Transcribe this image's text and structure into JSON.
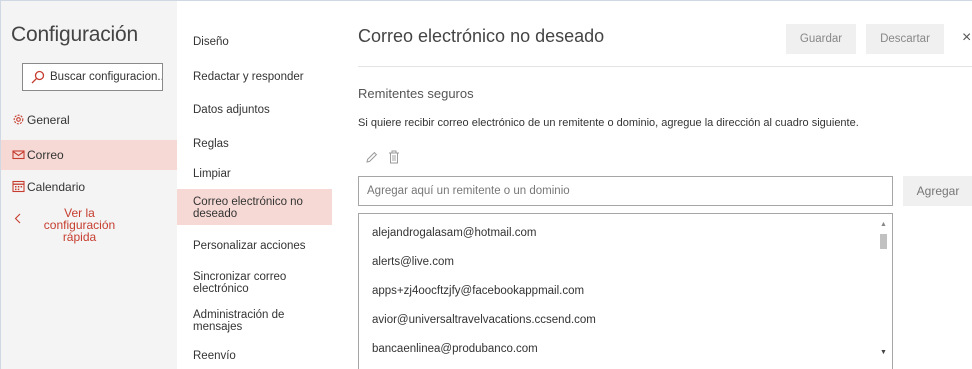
{
  "leftnav": {
    "title": "Configuración",
    "search_placeholder": "Buscar configuracion...",
    "items": [
      {
        "label": "General",
        "icon": "gear-icon"
      },
      {
        "label": "Correo",
        "icon": "mail-icon"
      },
      {
        "label": "Calendario",
        "icon": "calendar-icon"
      },
      {
        "label": "Ver la configuración rápida",
        "icon": "chevron-left-icon"
      }
    ]
  },
  "midnav": {
    "items": [
      {
        "label": "Diseño"
      },
      {
        "label": "Redactar y responder"
      },
      {
        "label": "Datos adjuntos"
      },
      {
        "label": "Reglas"
      },
      {
        "label": "Limpiar"
      },
      {
        "label": "Correo electrónico no deseado"
      },
      {
        "label": "Personalizar acciones"
      },
      {
        "label": "Sincronizar correo electrónico"
      },
      {
        "label": "Administración de mensajes"
      },
      {
        "label": "Reenvío"
      }
    ]
  },
  "main": {
    "title": "Correo electrónico no deseado",
    "save_label": "Guardar",
    "discard_label": "Descartar",
    "close_symbol": "×",
    "section_title": "Remitentes seguros",
    "description": "Si quiere recibir correo electrónico de un remitente o dominio, agregue la dirección al cuadro siguiente.",
    "add_placeholder": "Agregar aquí un remitente o un dominio",
    "add_label": "Agregar",
    "safe_senders": [
      "alejandrogalasam@hotmail.com",
      "alerts@live.com",
      "apps+zj4oocftzjfy@facebookappmail.com",
      "avior@universaltravelvacations.ccsend.com",
      "bancaenlinea@produbanco.com"
    ]
  },
  "colors": {
    "accent": "#c63d2f",
    "selected_bg": "#f6d9d4"
  }
}
